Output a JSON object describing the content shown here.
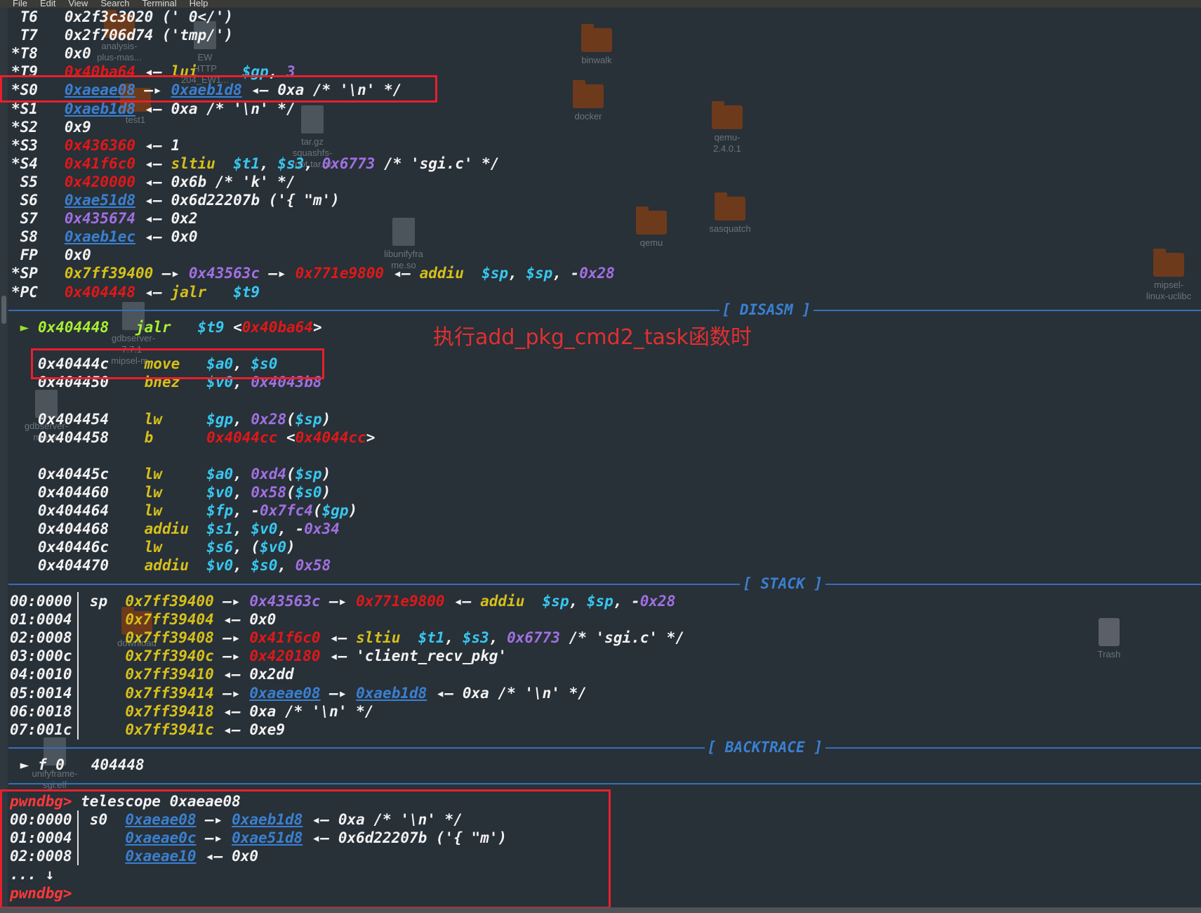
{
  "menu": [
    "File",
    "Edit",
    "View",
    "Search",
    "Terminal",
    "Help"
  ],
  "desktop": [
    {
      "label": "analysis-\nplus-mas...",
      "kind": "folder"
    },
    {
      "label": "EW\nHTTP\n204_EW1...",
      "kind": "file"
    },
    {
      "label": "binwalk",
      "kind": "folder"
    },
    {
      "label": "docker",
      "kind": "folder"
    },
    {
      "label": "qemu-\n2.4.0.1",
      "kind": "folder"
    },
    {
      "label": "test1",
      "kind": "folder"
    },
    {
      "label": "tar.gz\nsquashfs-\nroot.tar.gz",
      "kind": "file"
    },
    {
      "label": "qemu",
      "kind": "folder"
    },
    {
      "label": "sasquatch",
      "kind": "folder"
    },
    {
      "label": "libunifyfra\nme.so",
      "kind": "file"
    },
    {
      "label": "mipsel-\nlinux-uclibc",
      "kind": "folder"
    },
    {
      "label": "gdbserver-\n7.7.1-\nmipsel-m...",
      "kind": "file"
    },
    {
      "label": "gdbserver-\nmipsle",
      "kind": "file"
    },
    {
      "label": "download",
      "kind": "folder"
    },
    {
      "label": "Trash",
      "kind": "trash"
    },
    {
      "label": "unifyframe-\nsgi.elf",
      "kind": "file"
    }
  ],
  "registers": [
    [
      {
        "t": " T6   ",
        "c": "w"
      },
      {
        "t": "0x2f3c3020 (' 0</')",
        "c": "w"
      }
    ],
    [
      {
        "t": " T7   ",
        "c": "w"
      },
      {
        "t": "0x2f706d74 ('tmp/')",
        "c": "w"
      }
    ],
    [
      {
        "t": "*T8   ",
        "c": "w"
      },
      {
        "t": "0x0",
        "c": "w"
      }
    ],
    [
      {
        "t": "*T9   ",
        "c": "w"
      },
      {
        "t": "0x40ba64",
        "c": "red"
      },
      {
        "t": " ◂— ",
        "c": "w"
      },
      {
        "t": "lui     ",
        "c": "yellow"
      },
      {
        "t": "$gp",
        "c": "cyan"
      },
      {
        "t": ", ",
        "c": "w"
      },
      {
        "t": "3",
        "c": "purple"
      }
    ],
    [
      {
        "t": "*S0   ",
        "c": "w"
      },
      {
        "t": "0xaeae08",
        "c": "blue"
      },
      {
        "t": " —▸ ",
        "c": "w"
      },
      {
        "t": "0xaeb1d8",
        "c": "blue"
      },
      {
        "t": " ◂— 0xa /* '\\n' */",
        "c": "w"
      }
    ],
    [
      {
        "t": "*S1   ",
        "c": "w"
      },
      {
        "t": "0xaeb1d8",
        "c": "blue"
      },
      {
        "t": " ◂— 0xa /* '\\n' */",
        "c": "w"
      }
    ],
    [
      {
        "t": "*S2   ",
        "c": "w"
      },
      {
        "t": "0x9",
        "c": "w"
      }
    ],
    [
      {
        "t": "*S3   ",
        "c": "w"
      },
      {
        "t": "0x436360",
        "c": "red"
      },
      {
        "t": " ◂— 1",
        "c": "w"
      }
    ],
    [
      {
        "t": "*S4   ",
        "c": "w"
      },
      {
        "t": "0x41f6c0",
        "c": "red"
      },
      {
        "t": " ◂— ",
        "c": "w"
      },
      {
        "t": "sltiu  ",
        "c": "yellow"
      },
      {
        "t": "$t1",
        "c": "cyan"
      },
      {
        "t": ", ",
        "c": "w"
      },
      {
        "t": "$s3",
        "c": "cyan"
      },
      {
        "t": ", ",
        "c": "w"
      },
      {
        "t": "0x6773",
        "c": "purple"
      },
      {
        "t": " /* 'sgi.c' */",
        "c": "w"
      }
    ],
    [
      {
        "t": " S5   ",
        "c": "w"
      },
      {
        "t": "0x420000",
        "c": "red"
      },
      {
        "t": " ◂— 0x6b /* 'k' */",
        "c": "w"
      }
    ],
    [
      {
        "t": " S6   ",
        "c": "w"
      },
      {
        "t": "0xae51d8",
        "c": "blue"
      },
      {
        "t": " ◂— 0x6d22207b ('{ \"m')",
        "c": "w"
      }
    ],
    [
      {
        "t": " S7   ",
        "c": "w"
      },
      {
        "t": "0x435674",
        "c": "purple"
      },
      {
        "t": " ◂— 0x2",
        "c": "w"
      }
    ],
    [
      {
        "t": " S8   ",
        "c": "w"
      },
      {
        "t": "0xaeb1ec",
        "c": "blue"
      },
      {
        "t": " ◂— 0x0",
        "c": "w"
      }
    ],
    [
      {
        "t": " FP   ",
        "c": "w"
      },
      {
        "t": "0x0",
        "c": "w"
      }
    ],
    [
      {
        "t": "*SP   ",
        "c": "w"
      },
      {
        "t": "0x7ff39400",
        "c": "yellow"
      },
      {
        "t": " —▸ ",
        "c": "w"
      },
      {
        "t": "0x43563c",
        "c": "purple"
      },
      {
        "t": " —▸ ",
        "c": "w"
      },
      {
        "t": "0x771e9800",
        "c": "red"
      },
      {
        "t": " ◂— ",
        "c": "w"
      },
      {
        "t": "addiu  ",
        "c": "yellow"
      },
      {
        "t": "$sp",
        "c": "cyan"
      },
      {
        "t": ", ",
        "c": "w"
      },
      {
        "t": "$sp",
        "c": "cyan"
      },
      {
        "t": ", -",
        "c": "w"
      },
      {
        "t": "0x28",
        "c": "purple"
      }
    ],
    [
      {
        "t": "*PC   ",
        "c": "w"
      },
      {
        "t": "0x404448",
        "c": "red"
      },
      {
        "t": " ◂— ",
        "c": "w"
      },
      {
        "t": "jalr   ",
        "c": "yellow"
      },
      {
        "t": "$t9",
        "c": "cyan"
      }
    ]
  ],
  "headers": {
    "disasm": "[ DISASM ]",
    "stack": "[ STACK ]",
    "backtrace": "[ BACKTRACE ]"
  },
  "annotation": "执行add_pkg_cmd2_task函数时",
  "disasm": [
    {
      "row": 0,
      "segs": [
        {
          "t": " ► ",
          "c": "green"
        },
        {
          "t": "0x404448",
          "c": "lime"
        },
        {
          "t": "   ",
          "c": "w"
        },
        {
          "t": "jalr   ",
          "c": "lime"
        },
        {
          "t": "$t9",
          "c": "cyan"
        },
        {
          "t": " <",
          "c": "w"
        },
        {
          "t": "0x40ba64",
          "c": "red"
        },
        {
          "t": ">",
          "c": "w"
        }
      ]
    },
    {
      "row": 2,
      "segs": [
        {
          "t": "   0x40444c    ",
          "c": "w"
        },
        {
          "t": "move   ",
          "c": "yellow"
        },
        {
          "t": "$a0",
          "c": "cyan"
        },
        {
          "t": ", ",
          "c": "w"
        },
        {
          "t": "$s0",
          "c": "cyan"
        }
      ]
    },
    {
      "row": 3,
      "segs": [
        {
          "t": "   0x404450    ",
          "c": "w"
        },
        {
          "t": "bnez   ",
          "c": "yellow"
        },
        {
          "t": "$v0",
          "c": "cyan"
        },
        {
          "t": ", ",
          "c": "w"
        },
        {
          "t": "0x4043b8",
          "c": "purple"
        }
      ]
    },
    {
      "row": 5,
      "segs": [
        {
          "t": "   0x404454    ",
          "c": "w"
        },
        {
          "t": "lw     ",
          "c": "yellow"
        },
        {
          "t": "$gp",
          "c": "cyan"
        },
        {
          "t": ", ",
          "c": "w"
        },
        {
          "t": "0x28",
          "c": "purple"
        },
        {
          "t": "(",
          "c": "w"
        },
        {
          "t": "$sp",
          "c": "cyan"
        },
        {
          "t": ")",
          "c": "w"
        }
      ]
    },
    {
      "row": 6,
      "segs": [
        {
          "t": "   0x404458    ",
          "c": "w"
        },
        {
          "t": "b      ",
          "c": "yellow"
        },
        {
          "t": "0x4044cc",
          "c": "red"
        },
        {
          "t": " <",
          "c": "w"
        },
        {
          "t": "0x4044cc",
          "c": "red"
        },
        {
          "t": ">",
          "c": "w"
        }
      ]
    },
    {
      "row": 8,
      "segs": [
        {
          "t": "   0x40445c    ",
          "c": "w"
        },
        {
          "t": "lw     ",
          "c": "yellow"
        },
        {
          "t": "$a0",
          "c": "cyan"
        },
        {
          "t": ", ",
          "c": "w"
        },
        {
          "t": "0xd4",
          "c": "purple"
        },
        {
          "t": "(",
          "c": "w"
        },
        {
          "t": "$sp",
          "c": "cyan"
        },
        {
          "t": ")",
          "c": "w"
        }
      ]
    },
    {
      "row": 9,
      "segs": [
        {
          "t": "   0x404460    ",
          "c": "w"
        },
        {
          "t": "lw     ",
          "c": "yellow"
        },
        {
          "t": "$v0",
          "c": "cyan"
        },
        {
          "t": ", ",
          "c": "w"
        },
        {
          "t": "0x58",
          "c": "purple"
        },
        {
          "t": "(",
          "c": "w"
        },
        {
          "t": "$s0",
          "c": "cyan"
        },
        {
          "t": ")",
          "c": "w"
        }
      ]
    },
    {
      "row": 10,
      "segs": [
        {
          "t": "   0x404464    ",
          "c": "w"
        },
        {
          "t": "lw     ",
          "c": "yellow"
        },
        {
          "t": "$fp",
          "c": "cyan"
        },
        {
          "t": ", -",
          "c": "w"
        },
        {
          "t": "0x7fc4",
          "c": "purple"
        },
        {
          "t": "(",
          "c": "w"
        },
        {
          "t": "$gp",
          "c": "cyan"
        },
        {
          "t": ")",
          "c": "w"
        }
      ]
    },
    {
      "row": 11,
      "segs": [
        {
          "t": "   0x404468    ",
          "c": "w"
        },
        {
          "t": "addiu  ",
          "c": "yellow"
        },
        {
          "t": "$s1",
          "c": "cyan"
        },
        {
          "t": ", ",
          "c": "w"
        },
        {
          "t": "$v0",
          "c": "cyan"
        },
        {
          "t": ", -",
          "c": "w"
        },
        {
          "t": "0x34",
          "c": "purple"
        }
      ]
    },
    {
      "row": 12,
      "segs": [
        {
          "t": "   0x40446c    ",
          "c": "w"
        },
        {
          "t": "lw     ",
          "c": "yellow"
        },
        {
          "t": "$s6",
          "c": "cyan"
        },
        {
          "t": ", (",
          "c": "w"
        },
        {
          "t": "$v0",
          "c": "cyan"
        },
        {
          "t": ")",
          "c": "w"
        }
      ]
    },
    {
      "row": 13,
      "segs": [
        {
          "t": "   0x404470    ",
          "c": "w"
        },
        {
          "t": "addiu  ",
          "c": "yellow"
        },
        {
          "t": "$v0",
          "c": "cyan"
        },
        {
          "t": ", ",
          "c": "w"
        },
        {
          "t": "$s0",
          "c": "cyan"
        },
        {
          "t": ", ",
          "c": "w"
        },
        {
          "t": "0x58",
          "c": "purple"
        }
      ]
    }
  ],
  "stack": [
    [
      {
        "t": "00:0000",
        "c": "w"
      },
      {
        "t": "  sp  ",
        "c": "w"
      },
      {
        "t": "0x7ff39400",
        "c": "yellow"
      },
      {
        "t": " —▸ ",
        "c": "w"
      },
      {
        "t": "0x43563c",
        "c": "purple"
      },
      {
        "t": " —▸ ",
        "c": "w"
      },
      {
        "t": "0x771e9800",
        "c": "red"
      },
      {
        "t": " ◂— ",
        "c": "w"
      },
      {
        "t": "addiu  ",
        "c": "yellow"
      },
      {
        "t": "$sp",
        "c": "cyan"
      },
      {
        "t": ", ",
        "c": "w"
      },
      {
        "t": "$sp",
        "c": "cyan"
      },
      {
        "t": ", -",
        "c": "w"
      },
      {
        "t": "0x28",
        "c": "purple"
      }
    ],
    [
      {
        "t": "01:0004",
        "c": "w"
      },
      {
        "t": "      ",
        "c": "w"
      },
      {
        "t": "0x7ff39404",
        "c": "yellow"
      },
      {
        "t": " ◂— 0x0",
        "c": "w"
      }
    ],
    [
      {
        "t": "02:0008",
        "c": "w"
      },
      {
        "t": "      ",
        "c": "w"
      },
      {
        "t": "0x7ff39408",
        "c": "yellow"
      },
      {
        "t": " —▸ ",
        "c": "w"
      },
      {
        "t": "0x41f6c0",
        "c": "red"
      },
      {
        "t": " ◂— ",
        "c": "w"
      },
      {
        "t": "sltiu  ",
        "c": "yellow"
      },
      {
        "t": "$t1",
        "c": "cyan"
      },
      {
        "t": ", ",
        "c": "w"
      },
      {
        "t": "$s3",
        "c": "cyan"
      },
      {
        "t": ", ",
        "c": "w"
      },
      {
        "t": "0x6773",
        "c": "purple"
      },
      {
        "t": " /* 'sgi.c' */",
        "c": "w"
      }
    ],
    [
      {
        "t": "03:000c",
        "c": "w"
      },
      {
        "t": "      ",
        "c": "w"
      },
      {
        "t": "0x7ff3940c",
        "c": "yellow"
      },
      {
        "t": " —▸ ",
        "c": "w"
      },
      {
        "t": "0x420180",
        "c": "red"
      },
      {
        "t": " ◂— 'client_recv_pkg'",
        "c": "w"
      }
    ],
    [
      {
        "t": "04:0010",
        "c": "w"
      },
      {
        "t": "      ",
        "c": "w"
      },
      {
        "t": "0x7ff39410",
        "c": "yellow"
      },
      {
        "t": " ◂— 0x2dd",
        "c": "w"
      }
    ],
    [
      {
        "t": "05:0014",
        "c": "w"
      },
      {
        "t": "      ",
        "c": "w"
      },
      {
        "t": "0x7ff39414",
        "c": "yellow"
      },
      {
        "t": " —▸ ",
        "c": "w"
      },
      {
        "t": "0xaeae08",
        "c": "blue"
      },
      {
        "t": " —▸ ",
        "c": "w"
      },
      {
        "t": "0xaeb1d8",
        "c": "blue"
      },
      {
        "t": " ◂— 0xa /* '\\n' */",
        "c": "w"
      }
    ],
    [
      {
        "t": "06:0018",
        "c": "w"
      },
      {
        "t": "      ",
        "c": "w"
      },
      {
        "t": "0x7ff39418",
        "c": "yellow"
      },
      {
        "t": " ◂— 0xa /* '\\n' */",
        "c": "w"
      }
    ],
    [
      {
        "t": "07:001c",
        "c": "w"
      },
      {
        "t": "      ",
        "c": "w"
      },
      {
        "t": "0x7ff3941c",
        "c": "yellow"
      },
      {
        "t": " ◂— 0xe9",
        "c": "w"
      }
    ]
  ],
  "backtrace": [
    {
      "t": " ► f 0   404448",
      "c": "w"
    }
  ],
  "console": [
    [
      {
        "t": "pwndbg> ",
        "c": "prompt"
      },
      {
        "t": "telescope 0xaeae08",
        "c": "w"
      }
    ],
    [
      {
        "t": "00:0000",
        "c": "w"
      },
      {
        "t": "  s0  ",
        "c": "w"
      },
      {
        "t": "0xaeae08",
        "c": "blue"
      },
      {
        "t": " —▸ ",
        "c": "w"
      },
      {
        "t": "0xaeb1d8",
        "c": "blue"
      },
      {
        "t": " ◂— 0xa /* '\\n' */",
        "c": "w"
      }
    ],
    [
      {
        "t": "01:0004",
        "c": "w"
      },
      {
        "t": "      ",
        "c": "w"
      },
      {
        "t": "0xaeae0c",
        "c": "blue"
      },
      {
        "t": " —▸ ",
        "c": "w"
      },
      {
        "t": "0xae51d8",
        "c": "blue"
      },
      {
        "t": " ◂— 0x6d22207b ('{ \"m')",
        "c": "w"
      }
    ],
    [
      {
        "t": "02:0008",
        "c": "w"
      },
      {
        "t": "      ",
        "c": "w"
      },
      {
        "t": "0xaeae10",
        "c": "blue"
      },
      {
        "t": " ◂— 0x0",
        "c": "w"
      }
    ],
    [
      {
        "t": "... ↓",
        "c": "w"
      }
    ],
    [
      {
        "t": "pwndbg> ",
        "c": "prompt"
      }
    ]
  ]
}
